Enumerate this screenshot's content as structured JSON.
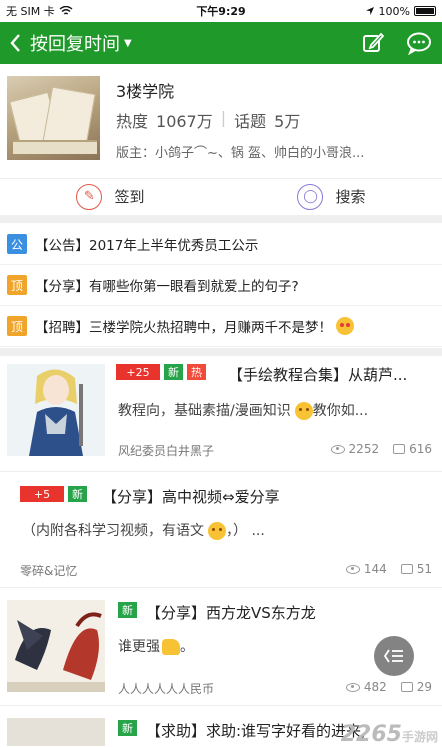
{
  "status_bar": {
    "carrier": "无 SIM 卡",
    "time": "下午9:29",
    "battery": "100%"
  },
  "nav": {
    "back_icon": "chevron-left-icon",
    "title": "按回复时间",
    "edit_icon": "edit-icon",
    "chat_icon": "chat-icon"
  },
  "forum": {
    "name": "3楼学院",
    "heat_label": "热度",
    "heat_value": "1067万",
    "topics_label": "话题",
    "topics_value": "5万",
    "moderators": "版主：小鸽子⌒~、锅 盔、帅白的小哥浪..."
  },
  "actions": {
    "checkin": "签到",
    "search": "搜索"
  },
  "notices": [
    {
      "tag": "公",
      "text": "【公告】2017年上半年优秀员工公示"
    },
    {
      "tag": "顶",
      "text": "【分享】有哪些你第一眼看到就爱上的句子?"
    },
    {
      "tag": "顶",
      "text": "【招聘】三楼学院火热招聘中，月赚两千不是梦！"
    }
  ],
  "posts": [
    {
      "level": "+25",
      "new": "新",
      "hot": "热",
      "title": "【手绘教程合集】从葫芦...",
      "body": "教程向，基础素描/漫画知识",
      "body_tail": "教你如...",
      "author": "风纪委员白井黑子",
      "views": "2252",
      "replies": "616"
    },
    {
      "level": "+5",
      "new": "新",
      "title": "【分享】高中视频⇔爱分享",
      "body": "（内附各科学习视频，有语文",
      "body_tail": "，）  ...",
      "author": "零碎&记忆",
      "views": "144",
      "replies": "51"
    },
    {
      "new": "新",
      "title": "【分享】西方龙VS东方龙",
      "body": "谁更强",
      "body_tail": "。",
      "author": "人人人人人人民币",
      "views": "482",
      "replies": "29"
    },
    {
      "new": "新",
      "title": "【求助】求助:谁写字好看的进来,"
    }
  ],
  "watermark": {
    "brand": "2265",
    "sub": "手游网"
  }
}
